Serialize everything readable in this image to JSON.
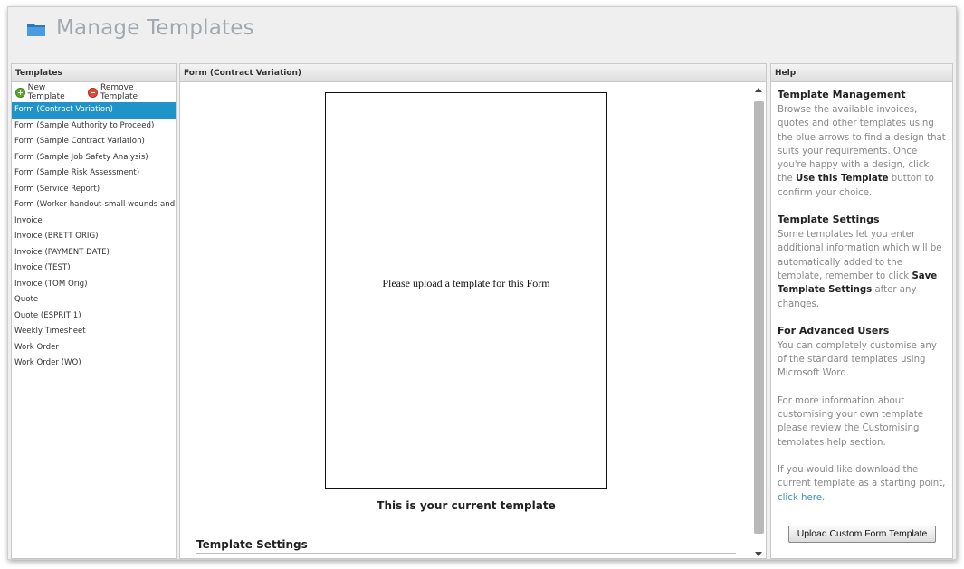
{
  "header": {
    "title": "Manage Templates",
    "icon": "folder-icon"
  },
  "templates_panel": {
    "heading": "Templates",
    "new_label": "New Template",
    "remove_label": "Remove Template",
    "items": [
      "Form (Contract Variation)",
      "Form (Sample Authority to Proceed)",
      "Form (Sample Contract Variation)",
      "Form (Sample Job Safety Analysis)",
      "Form (Sample Risk Assessment)",
      "Form (Service Report)",
      "Form (Worker handout-small wounds and c",
      "Invoice",
      "Invoice (BRETT ORIG)",
      "Invoice (PAYMENT DATE)",
      "Invoice (TEST)",
      "Invoice (TOM Orig)",
      "Quote",
      "Quote (ESPRIT 1)",
      "Weekly Timesheet",
      "Work Order",
      "Work Order (WO)"
    ],
    "selected_index": 0
  },
  "preview_panel": {
    "heading": "Form (Contract Variation)",
    "placeholder": "Please upload a template for this Form",
    "caption": "This is your current template",
    "settings_heading": "Template Settings"
  },
  "help_panel": {
    "heading": "Help",
    "s1_title": "Template Management",
    "s1_text_a": "Browse the available invoices, quotes and other templates using the blue arrows to find a design that suits your requirements. Once you're happy with a design, click the ",
    "s1_bold": "Use this Template",
    "s1_text_b": " button to confirm your choice.",
    "s2_title": "Template Settings",
    "s2_text_a": "Some templates let you enter additional information which will be automatically added to the template, remember to click ",
    "s2_bold": "Save Template Settings",
    "s2_text_b": " after any changes.",
    "s3_title": "For Advanced Users",
    "s3_text": "You can completely customise any of the standard templates using Microsoft Word.",
    "s4_text": "For more information about customising your own template please review the Customising templates help section.",
    "s5_text": "If you would like download the current template as a starting point, ",
    "s5_link": "click here.",
    "upload_label": "Upload Custom Form Template"
  },
  "colors": {
    "accent": "#2094c9",
    "link": "#3a8fc2",
    "folder": "#3f8fd0"
  }
}
